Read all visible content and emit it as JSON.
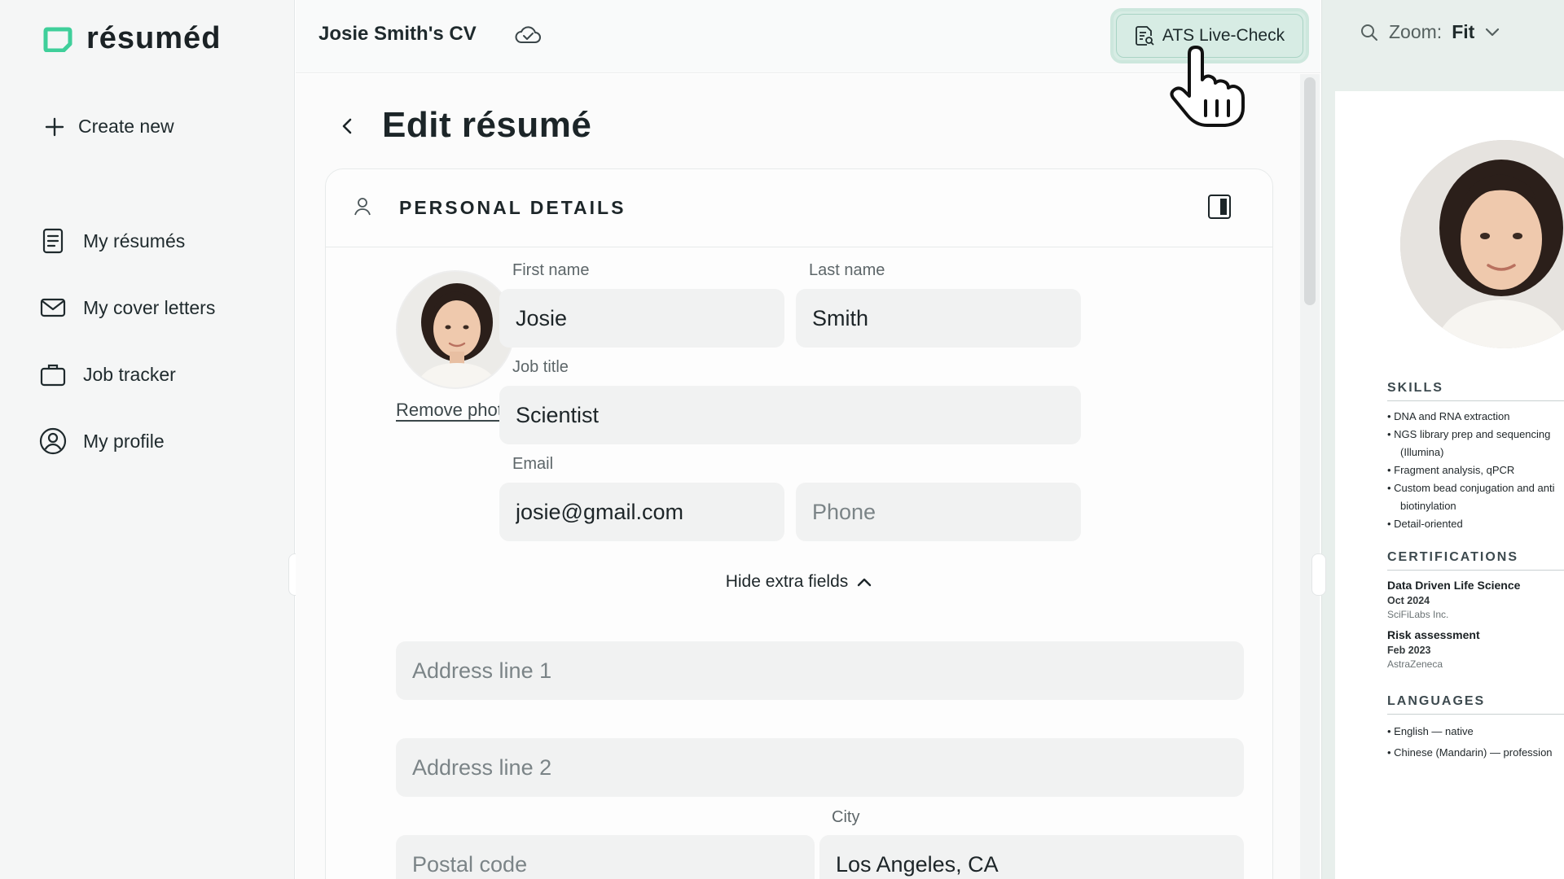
{
  "brand": {
    "name": "résuméd",
    "accent": "#3fcf9a"
  },
  "sidebar": {
    "create_new": "Create new",
    "items": [
      {
        "label": "My résumés",
        "icon": "document-icon"
      },
      {
        "label": "My cover letters",
        "icon": "mail-icon"
      },
      {
        "label": "Job tracker",
        "icon": "briefcase-icon"
      },
      {
        "label": "My profile",
        "icon": "user-circle-icon"
      }
    ]
  },
  "header": {
    "doc_title": "Josie Smith's CV",
    "ats_button": "ATS Live-Check",
    "zoom_label": "Zoom:",
    "zoom_value": "Fit"
  },
  "editor": {
    "title": "Edit résumé",
    "section_title": "PERSONAL DETAILS",
    "remove_photo": "Remove photo",
    "hide_extra": "Hide extra fields",
    "fields": {
      "first_name": {
        "label": "First name",
        "value": "Josie"
      },
      "last_name": {
        "label": "Last name",
        "value": "Smith"
      },
      "job_title": {
        "label": "Job title",
        "value": "Scientist"
      },
      "email": {
        "label": "Email",
        "value": "josie@gmail.com"
      },
      "phone": {
        "placeholder": "Phone"
      },
      "address1": {
        "placeholder": "Address line 1"
      },
      "address2": {
        "placeholder": "Address line 2"
      },
      "postal": {
        "placeholder": "Postal code"
      },
      "city": {
        "label": "City",
        "value": "Los Angeles, CA"
      }
    }
  },
  "preview": {
    "skills_title": "SKILLS",
    "skills": [
      "• DNA and RNA extraction",
      "• NGS library prep and sequencing",
      "(Illumina)",
      "• Fragment analysis, qPCR",
      "• Custom bead conjugation and anti",
      "biotinylation",
      "• Detail-oriented"
    ],
    "certs_title": "CERTIFICATIONS",
    "certs": [
      {
        "title": "Data Driven Life Science",
        "date": "Oct 2024",
        "org": "SciFiLabs Inc."
      },
      {
        "title": "Risk assessment",
        "date": "Feb 2023",
        "org": "AstraZeneca"
      }
    ],
    "languages_title": "LANGUAGES",
    "languages": [
      "• English — native",
      "• Chinese (Mandarin) — profession"
    ]
  }
}
